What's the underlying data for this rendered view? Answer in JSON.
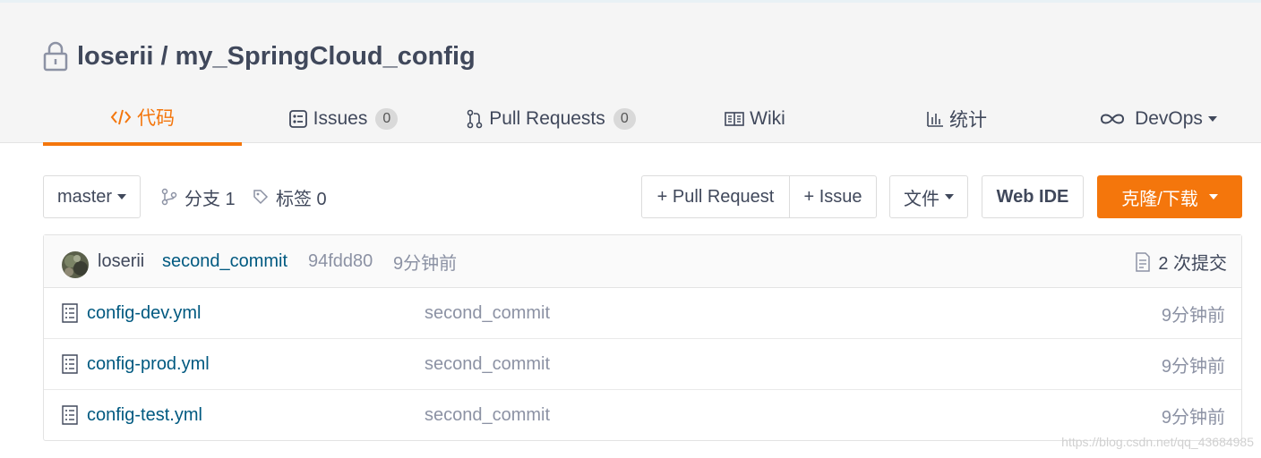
{
  "repo": {
    "owner": "loserii",
    "separator": " / ",
    "name": "my_SpringCloud_config"
  },
  "tabs": [
    {
      "label": "代码",
      "icon": "code-icon",
      "active": true
    },
    {
      "label": "Issues",
      "count": "0",
      "icon": "issues-icon"
    },
    {
      "label": "Pull Requests",
      "count": "0",
      "icon": "pull-request-icon"
    },
    {
      "label": "Wiki",
      "icon": "wiki-icon"
    },
    {
      "label": "统计",
      "icon": "stats-icon"
    },
    {
      "label": "DevOps",
      "icon": "devops-icon"
    }
  ],
  "toolbar": {
    "branch": "master",
    "branches_label": "分支 1",
    "tags_label": "标签 0",
    "new_pr": "+ Pull Request",
    "new_issue": "+ Issue",
    "file_menu": "文件",
    "web_ide": "Web IDE",
    "clone": "克隆/下载"
  },
  "last_commit": {
    "author": "loserii",
    "message": "second_commit",
    "hash": "94fdd80",
    "time": "9分钟前",
    "commit_count": "2 次提交"
  },
  "files": [
    {
      "name": "config-dev.yml",
      "message": "second_commit",
      "time": "9分钟前"
    },
    {
      "name": "config-prod.yml",
      "message": "second_commit",
      "time": "9分钟前"
    },
    {
      "name": "config-test.yml",
      "message": "second_commit",
      "time": "9分钟前"
    }
  ],
  "watermark": "https://blog.csdn.net/qq_43684985",
  "colors": {
    "accent": "#f4760c",
    "link": "#005980",
    "text": "#40485b",
    "muted": "#8c92a4"
  }
}
